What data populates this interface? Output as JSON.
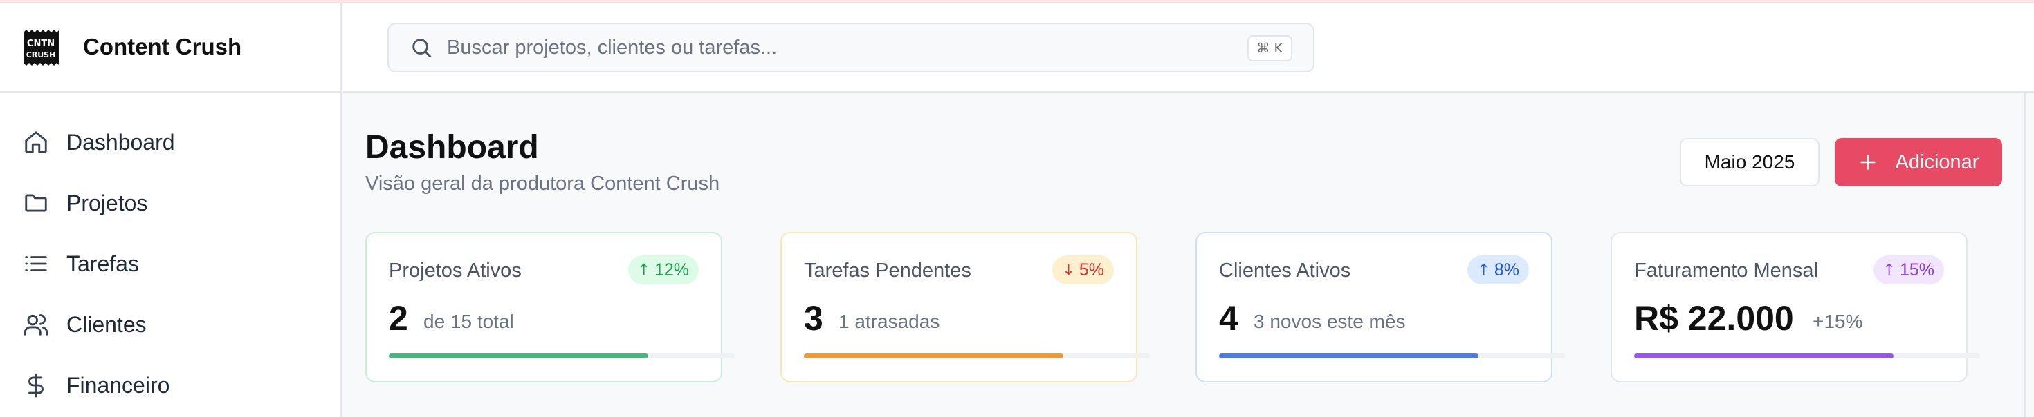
{
  "brand": {
    "name": "Content Crush",
    "logo_text": "CNTN CRUSH"
  },
  "sidebar": {
    "items": [
      {
        "label": "Dashboard",
        "icon": "home-icon"
      },
      {
        "label": "Projetos",
        "icon": "folder-icon"
      },
      {
        "label": "Tarefas",
        "icon": "list-icon"
      },
      {
        "label": "Clientes",
        "icon": "users-icon"
      },
      {
        "label": "Financeiro",
        "icon": "dollar-icon"
      }
    ]
  },
  "search": {
    "placeholder": "Buscar projetos, clientes ou tarefas...",
    "value": "",
    "shortcut": "⌘ K"
  },
  "header": {
    "title": "Dashboard",
    "subtitle": "Visão geral da produtora Content Crush",
    "month_label": "Maio 2025",
    "add_label": "Adicionar"
  },
  "cards": [
    {
      "label": "Projetos Ativos",
      "badge": "12%",
      "badge_direction": "up",
      "value": "2",
      "sub": "de 15 total",
      "progress": 0.75,
      "accent": "#48b97c",
      "badge_bg": "#dcfce7",
      "badge_color": "#1f9a4f",
      "border": "#c9eed7"
    },
    {
      "label": "Tarefas Pendentes",
      "badge": "5%",
      "badge_direction": "down",
      "value": "3",
      "sub": "1 atrasadas",
      "progress": 0.75,
      "accent": "#f09a35",
      "badge_bg": "#fdf0cf",
      "badge_color": "#d63333",
      "border": "#fbe7b5"
    },
    {
      "label": "Clientes Ativos",
      "badge": "8%",
      "badge_direction": "up",
      "value": "4",
      "sub": "3 novos este mês",
      "progress": 0.75,
      "accent": "#4a7de6",
      "badge_bg": "#dbeafe",
      "badge_color": "#2459c7",
      "border": "#cfdff7"
    },
    {
      "label": "Faturamento Mensal",
      "badge": "15%",
      "badge_direction": "up",
      "value": "R$ 22.000",
      "sub": "+15%",
      "progress": 0.75,
      "accent": "#9a55ea",
      "badge_bg": "#f1e6fd",
      "badge_color": "#8a3fd6",
      "border": "#e5e7eb"
    }
  ],
  "colors": {
    "primary": "#e64b63",
    "background": "#f8f9fb"
  }
}
